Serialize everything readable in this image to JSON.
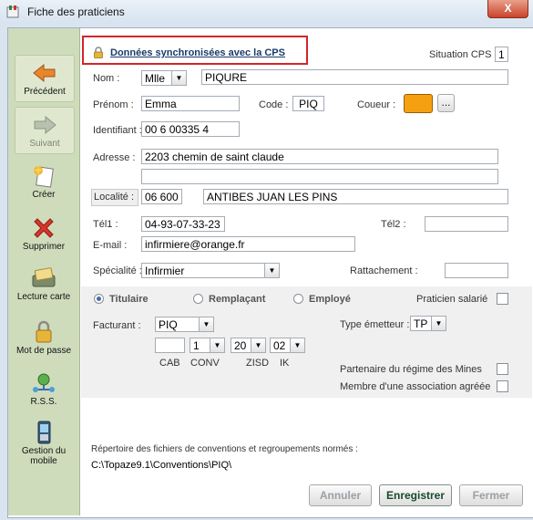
{
  "window": {
    "title": "Fiche des praticiens",
    "close_label": "X"
  },
  "sync": {
    "label": "Données synchronisées avec la CPS"
  },
  "situation": {
    "label": "Situation CPS :",
    "value": "1"
  },
  "sidebar": {
    "items": [
      {
        "label": "Précédent",
        "icon": "arrow-left-icon"
      },
      {
        "label": "Suivant",
        "icon": "arrow-right-icon"
      },
      {
        "label": "Créer",
        "icon": "new-document-icon"
      },
      {
        "label": "Supprimer",
        "icon": "delete-x-icon"
      },
      {
        "label": "Lecture carte",
        "icon": "card-reader-icon"
      },
      {
        "label": "Mot de passe",
        "icon": "padlock-icon"
      },
      {
        "label": "R.S.S.",
        "icon": "network-icon"
      },
      {
        "label": "Gestion du mobile",
        "icon": "mobile-phone-icon"
      }
    ]
  },
  "form": {
    "nom_label": "Nom :",
    "civilite": "Mlle",
    "nom": "PIQURE",
    "prenom_label": "Prénom :",
    "prenom": "Emma",
    "code_label": "Code :",
    "code": "PIQ",
    "couleur_label": "Coueur :",
    "couleur_color": "#f5a010",
    "couleur_btn": "...",
    "identifiant_label": "Identifiant :",
    "identifiant": "00 6 00335 4",
    "adresse_label": "Adresse :",
    "adresse1": "2203 chemin de saint claude",
    "adresse2": "",
    "localite_label": "Localité :",
    "cp": "06 600",
    "ville": "ANTIBES JUAN LES PINS",
    "tel1_label": "Tél1 :",
    "tel1": "04-93-07-33-23",
    "tel2_label": "Tél2 :",
    "tel2": "",
    "email_label": "E-mail :",
    "email": "infirmiere@orange.fr",
    "specialite_label": "Spécialité :",
    "specialite": "Infirmier",
    "rattachement_label": "Rattachement :",
    "rattachement": ""
  },
  "status": {
    "titulaire": "Titulaire",
    "remplacant": "Remplaçant",
    "employe": "Employé",
    "salarie_label": "Praticien salarié",
    "facturant_label": "Facturant :",
    "facturant": "PIQ",
    "emetteur_label": "Type émetteur :",
    "emetteur": "TP",
    "cab": "",
    "conv": "1",
    "zisd": "20",
    "ik": "02",
    "cab_label": "CAB",
    "conv_label": "CONV",
    "zisd_label": "ZISD",
    "ik_label": "IK",
    "mines_label": "Partenaire du régime des Mines",
    "assoc_label": "Membre d'une association agréée"
  },
  "footer": {
    "repertoire_label": "Répertoire des fichiers de conventions et regroupements normés :",
    "repertoire_path": "C:\\Topaze9.1\\Conventions\\PIQ\\",
    "annuler": "Annuler",
    "enregistrer": "Enregistrer",
    "fermer": "Fermer"
  }
}
